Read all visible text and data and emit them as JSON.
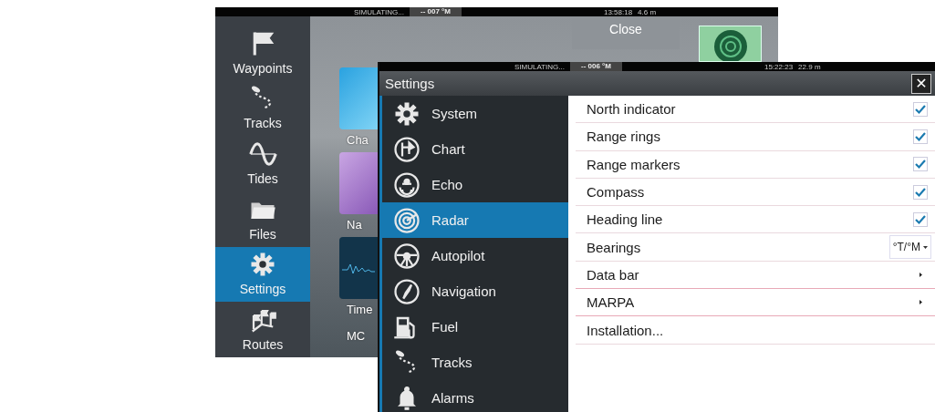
{
  "background_window": {
    "status_bar": {
      "label": "SIMULATING...",
      "heading": "-- 007 °M",
      "time": "13:58:18",
      "depth": "4.6 m"
    },
    "sidebar": {
      "items": [
        {
          "label": "Waypoints",
          "selected": false
        },
        {
          "label": "Tracks",
          "selected": false
        },
        {
          "label": "Tides",
          "selected": false
        },
        {
          "label": "Files",
          "selected": false
        },
        {
          "label": "Settings",
          "selected": true
        },
        {
          "label": "Routes",
          "selected": false
        }
      ]
    },
    "tiles": [
      {
        "label": "Cha",
        "kind": "chart"
      },
      {
        "label": "Na",
        "kind": "navigation"
      },
      {
        "label": "Time",
        "kind": "time"
      },
      {
        "label": "MC",
        "kind": "text"
      }
    ],
    "close_button": "Close"
  },
  "settings_window": {
    "status_bar": {
      "label": "SIMULATING...",
      "heading": "-- 006 °M",
      "time": "15:22:23",
      "depth": "22.9 m"
    },
    "title": "Settings",
    "close_button": "✕",
    "menu": [
      {
        "label": "System",
        "selected": false
      },
      {
        "label": "Chart",
        "selected": false
      },
      {
        "label": "Echo",
        "selected": false
      },
      {
        "label": "Radar",
        "selected": true
      },
      {
        "label": "Autopilot",
        "selected": false
      },
      {
        "label": "Navigation",
        "selected": false
      },
      {
        "label": "Fuel",
        "selected": false
      },
      {
        "label": "Tracks",
        "selected": false
      },
      {
        "label": "Alarms",
        "selected": false
      }
    ],
    "rows": [
      {
        "kind": "checkbox",
        "label": "North indicator",
        "checked": true
      },
      {
        "kind": "checkbox",
        "label": "Range rings",
        "checked": true
      },
      {
        "kind": "checkbox",
        "label": "Range markers",
        "checked": true
      },
      {
        "kind": "checkbox",
        "label": "Compass",
        "checked": true
      },
      {
        "kind": "checkbox",
        "label": "Heading line",
        "checked": true
      },
      {
        "kind": "dropdown",
        "label": "Bearings",
        "value": "°T/°M"
      },
      {
        "kind": "submenu",
        "label": "Data bar"
      },
      {
        "kind": "submenu",
        "label": "MARPA"
      },
      {
        "kind": "action",
        "label": "Installation..."
      }
    ]
  }
}
